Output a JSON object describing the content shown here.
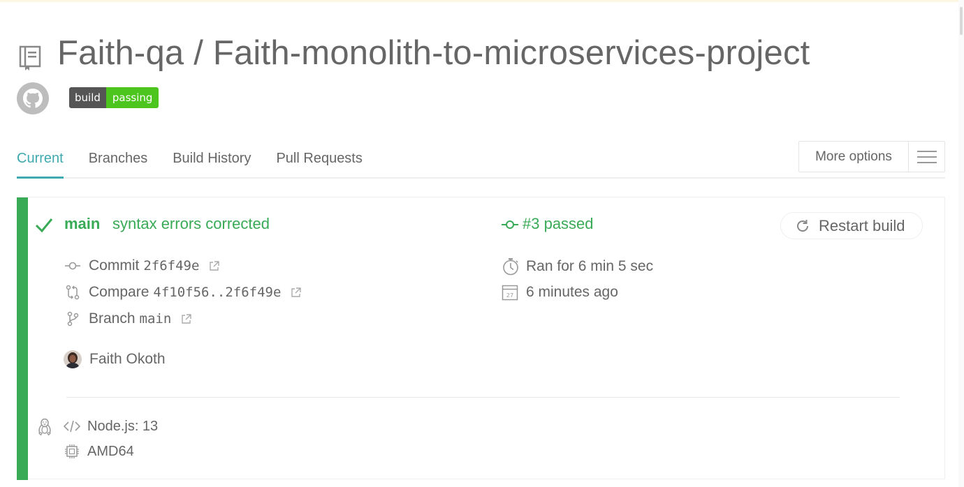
{
  "repo": {
    "owner": "Faith-qa",
    "separator": "/",
    "name": "Faith-monolith-to-microservices-project",
    "badge": {
      "left": "build",
      "right": "passing",
      "color": "#4cc61e"
    }
  },
  "tabs": [
    {
      "label": "Current",
      "active": true
    },
    {
      "label": "Branches",
      "active": false
    },
    {
      "label": "Build History",
      "active": false
    },
    {
      "label": "Pull Requests",
      "active": false
    }
  ],
  "more_options": {
    "label": "More options",
    "icon": "hamburger-icon"
  },
  "build": {
    "status": "passed",
    "status_color": "#39aa56",
    "branch": "main",
    "message": "syntax errors corrected",
    "number_text": "#3 passed",
    "restart_label": "Restart build",
    "commit": {
      "label": "Commit",
      "value": "2f6f49e"
    },
    "compare": {
      "label": "Compare",
      "value": "4f10f56..2f6f49e"
    },
    "branch_row": {
      "label": "Branch",
      "value": "main"
    },
    "duration": "Ran for 6 min 5 sec",
    "calendar_day": "27",
    "finished": "6 minutes ago",
    "author": "Faith Okoth",
    "language": "Node.js: 13",
    "arch": "AMD64",
    "os_icon": "linux-tux-icon"
  }
}
